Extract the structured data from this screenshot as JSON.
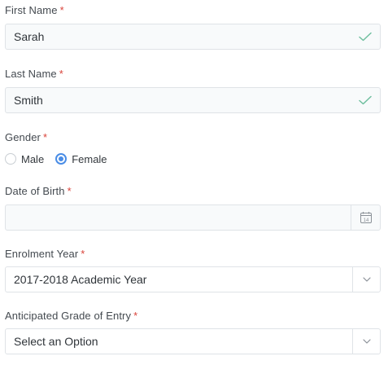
{
  "form": {
    "required_mark": "*",
    "first_name": {
      "label": "First Name",
      "value": "Sarah",
      "valid": true
    },
    "last_name": {
      "label": "Last Name",
      "value": "Smith",
      "valid": true
    },
    "gender": {
      "label": "Gender",
      "options": [
        {
          "label": "Male",
          "selected": false
        },
        {
          "label": "Female",
          "selected": true
        }
      ]
    },
    "dob": {
      "label": "Date of Birth",
      "value": "",
      "calendar_day": "14"
    },
    "enrolment_year": {
      "label": "Enrolment Year",
      "value": "2017-2018 Academic Year"
    },
    "grade": {
      "label": "Anticipated Grade of Entry",
      "value": "Select an Option"
    }
  },
  "colors": {
    "accent": "#4a8de6",
    "valid_check": "#6fbf9f",
    "required": "#d9433a",
    "border": "#dfe3e7"
  },
  "icons": {
    "valid": "check-icon",
    "calendar": "calendar-icon",
    "dropdown": "chevron-down-icon"
  }
}
